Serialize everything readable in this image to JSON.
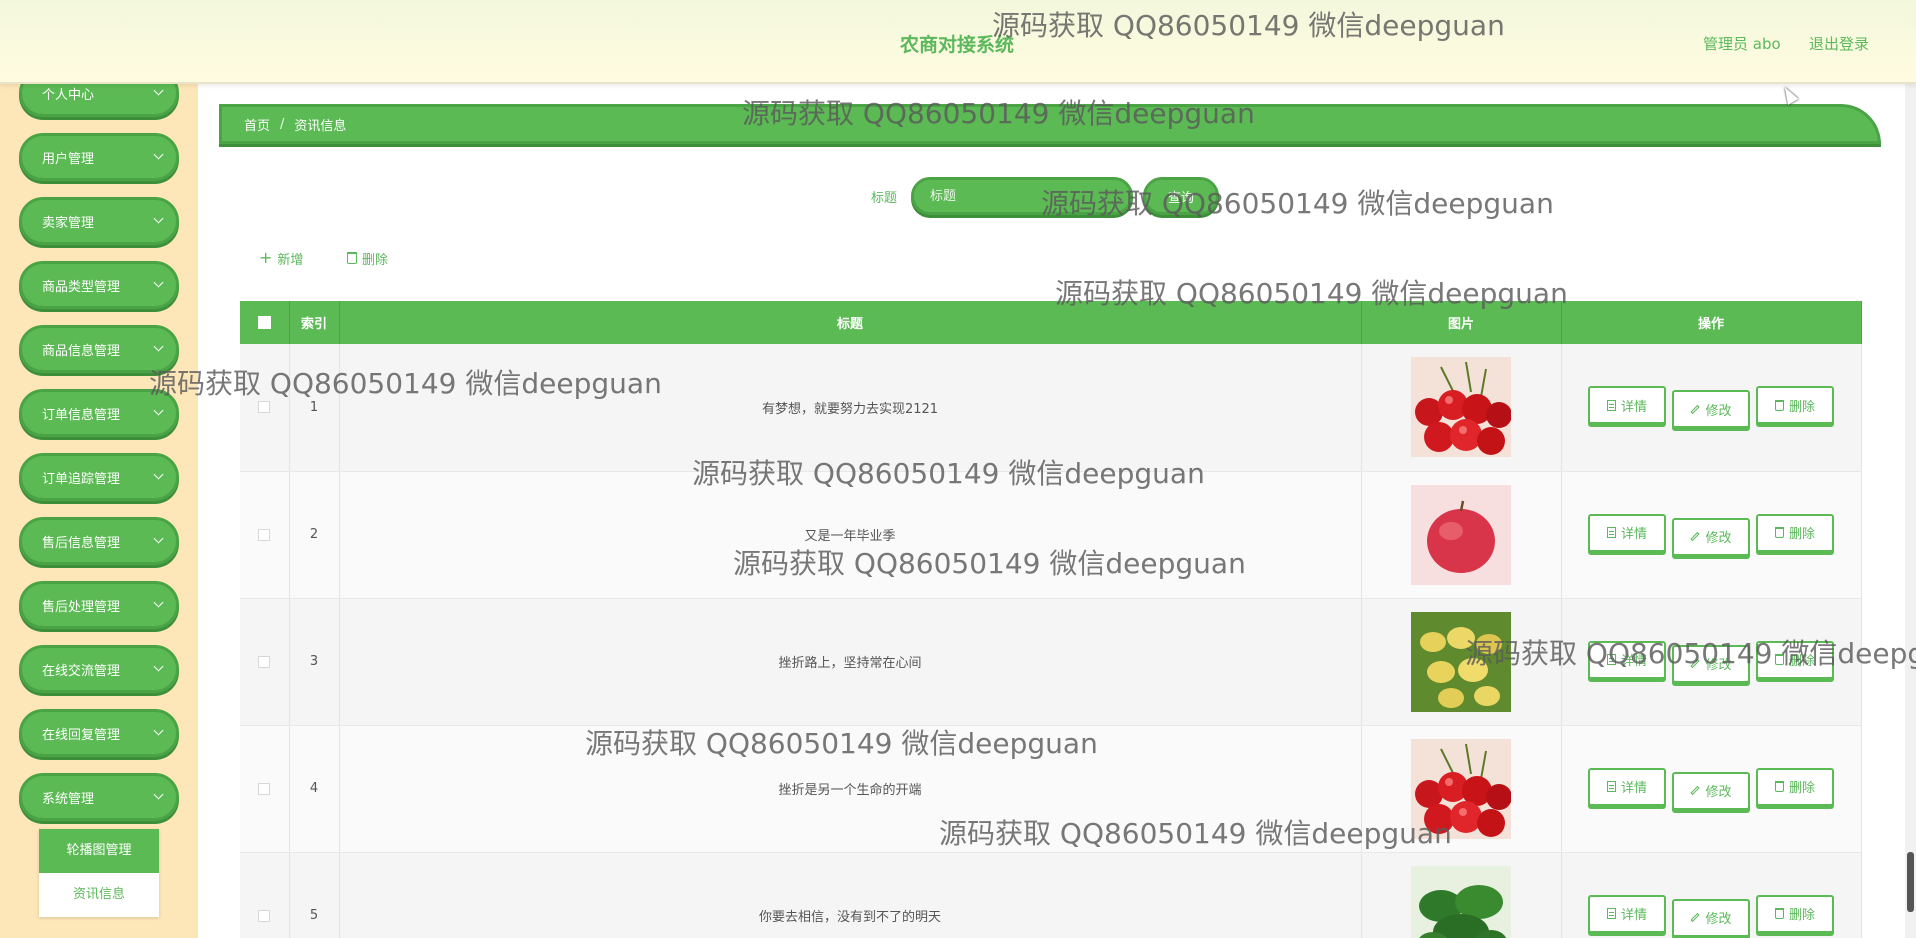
{
  "header": {
    "title": "农商对接系统",
    "admin_label": "管理员 abo",
    "logout_label": "退出登录"
  },
  "sidebar": {
    "items": [
      {
        "label": "个人中心"
      },
      {
        "label": "用户管理"
      },
      {
        "label": "卖家管理"
      },
      {
        "label": "商品类型管理"
      },
      {
        "label": "商品信息管理"
      },
      {
        "label": "订单信息管理"
      },
      {
        "label": "订单追踪管理"
      },
      {
        "label": "售后信息管理"
      },
      {
        "label": "售后处理管理"
      },
      {
        "label": "在线交流管理"
      },
      {
        "label": "在线回复管理"
      },
      {
        "label": "系统管理"
      }
    ],
    "submenu": [
      {
        "label": "轮播图管理"
      },
      {
        "label": "资讯信息"
      }
    ]
  },
  "breadcrumb": {
    "home": "首页",
    "separator": "/",
    "current": "资讯信息"
  },
  "search": {
    "label": "标题",
    "placeholder": "标题",
    "button_label": "查询"
  },
  "actions": {
    "add_label": "新增",
    "delete_label": "删除"
  },
  "table": {
    "headers": {
      "index": "索引",
      "title": "标题",
      "image": "图片",
      "operations": "操作"
    },
    "op_labels": {
      "detail": "详情",
      "edit": "修改",
      "delete": "删除"
    },
    "rows": [
      {
        "index": "1",
        "title": "有梦想，就要努力去实现2121",
        "image": "cherries"
      },
      {
        "index": "2",
        "title": "又是一年毕业季",
        "image": "apple"
      },
      {
        "index": "3",
        "title": "挫折路上，坚持常在心间",
        "image": "potatoes"
      },
      {
        "index": "4",
        "title": "挫折是另一个生命的开端",
        "image": "cherries"
      },
      {
        "index": "5",
        "title": "你要去相信，没有到不了的明天",
        "image": "greens"
      }
    ]
  },
  "watermark_text": "源码获取 QQ86050149 微信deepguan",
  "colors": {
    "primary_green": "#5cba54",
    "header_bg": "#fffbe0",
    "sidebar_bg": "#fde6b8"
  }
}
